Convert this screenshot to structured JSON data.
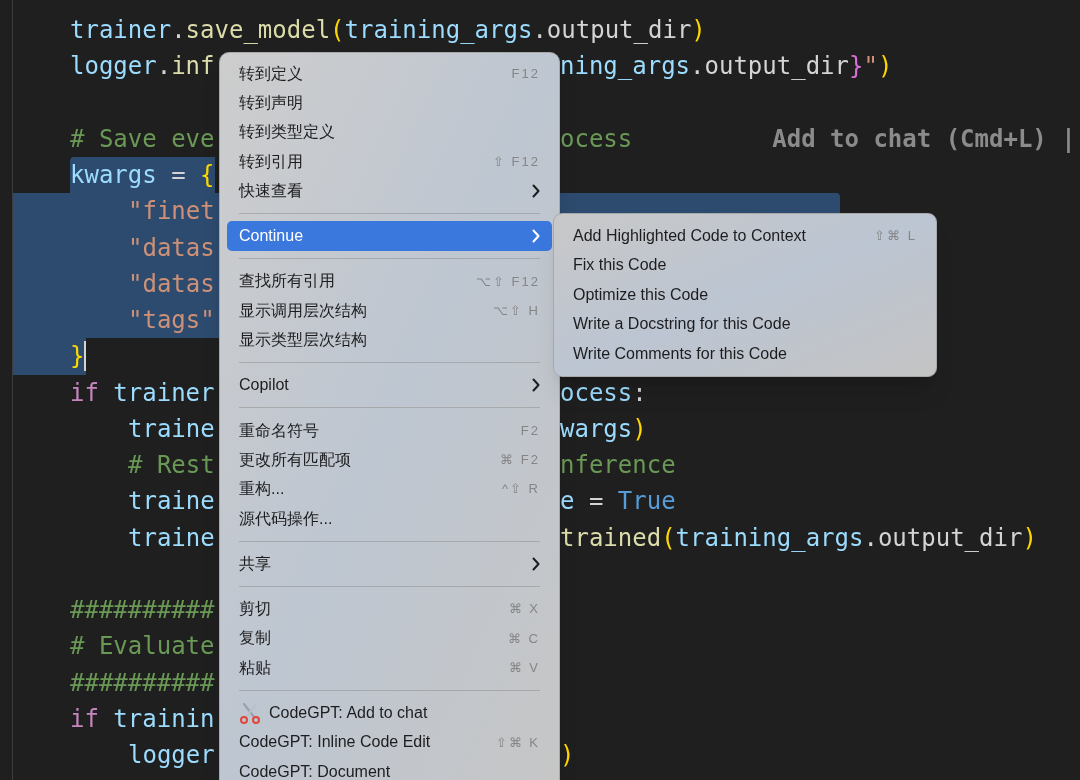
{
  "editor": {
    "lines": [
      {
        "kind": "code",
        "indented": false,
        "selected": false,
        "selection_start": false,
        "selection_end": false,
        "cursor": false,
        "left": [
          {
            "text": "trainer",
            "kind": "ident"
          },
          {
            "text": ".",
            "kind": "plain"
          },
          {
            "text": "save_model",
            "kind": "func"
          },
          {
            "text": "(",
            "kind": "paren"
          },
          {
            "text": "training_args",
            "kind": "ident"
          },
          {
            "text": ".",
            "kind": "plain"
          },
          {
            "text": "output_dir",
            "kind": "plain"
          },
          {
            "text": ")",
            "kind": "paren"
          }
        ]
      },
      {
        "kind": "code",
        "indented": false,
        "selected": false,
        "selection_start": false,
        "selection_end": false,
        "cursor": false,
        "left": [
          {
            "text": "logger",
            "kind": "ident"
          },
          {
            "text": ".",
            "kind": "plain"
          },
          {
            "text": "inf",
            "kind": "func"
          }
        ],
        "right": [
          {
            "text": "ning_args",
            "kind": "ident"
          },
          {
            "text": ".",
            "kind": "plain"
          },
          {
            "text": "output_dir",
            "kind": "plain"
          },
          {
            "text": "}",
            "kind": "brace"
          },
          {
            "text": "\"",
            "kind": "string"
          },
          {
            "text": ")",
            "kind": "paren"
          }
        ]
      },
      {
        "kind": "blank"
      },
      {
        "kind": "code",
        "indented": false,
        "selected": false,
        "selection_start": false,
        "selection_end": false,
        "cursor": false,
        "left": [
          {
            "text": "# Save eve",
            "kind": "comment"
          }
        ],
        "right": [
          {
            "text": "ocess",
            "kind": "comment"
          }
        ],
        "hint": "Add to chat (Cmd+L) |"
      },
      {
        "kind": "code",
        "indented": false,
        "selected": true,
        "selection_start": true,
        "selection_end": false,
        "cursor": false,
        "left": [
          {
            "text": "kwargs",
            "kind": "ident"
          },
          {
            "text": " = ",
            "kind": "plain"
          },
          {
            "text": "{",
            "kind": "paren"
          }
        ]
      },
      {
        "kind": "code",
        "indented": true,
        "selected": true,
        "selection_start": false,
        "selection_end": false,
        "cursor": false,
        "left": [
          {
            "text": "\"finet",
            "kind": "string"
          }
        ],
        "right_selected": true
      },
      {
        "kind": "code",
        "indented": true,
        "selected": true,
        "selection_start": false,
        "selection_end": false,
        "cursor": false,
        "left": [
          {
            "text": "\"datas",
            "kind": "string"
          }
        ]
      },
      {
        "kind": "code",
        "indented": true,
        "selected": true,
        "selection_start": false,
        "selection_end": false,
        "cursor": false,
        "left": [
          {
            "text": "\"datas",
            "kind": "string"
          }
        ]
      },
      {
        "kind": "code",
        "indented": true,
        "selected": true,
        "selection_start": false,
        "selection_end": false,
        "cursor": false,
        "left": [
          {
            "text": "\"tags\"",
            "kind": "string"
          }
        ]
      },
      {
        "kind": "code",
        "indented": false,
        "selected": true,
        "selection_start": false,
        "selection_end": true,
        "cursor": true,
        "left": [
          {
            "text": "}",
            "kind": "paren"
          }
        ]
      },
      {
        "kind": "code",
        "indented": false,
        "selected": false,
        "selection_start": false,
        "selection_end": false,
        "cursor": false,
        "left": [
          {
            "text": "if",
            "kind": "keyword"
          },
          {
            "text": " trainer",
            "kind": "ident"
          }
        ],
        "right": [
          {
            "text": "ocess",
            "kind": "ident"
          },
          {
            "text": ":",
            "kind": "plain"
          }
        ]
      },
      {
        "kind": "code",
        "indented": true,
        "selected": false,
        "selection_start": false,
        "selection_end": false,
        "cursor": false,
        "left": [
          {
            "text": "traine",
            "kind": "ident"
          }
        ],
        "right": [
          {
            "text": "wargs",
            "kind": "ident"
          },
          {
            "text": ")",
            "kind": "paren"
          }
        ]
      },
      {
        "kind": "code",
        "indented": true,
        "selected": false,
        "selection_start": false,
        "selection_end": false,
        "cursor": false,
        "left": [
          {
            "text": "# Rest",
            "kind": "comment"
          }
        ],
        "right": [
          {
            "text": "nference",
            "kind": "comment"
          }
        ]
      },
      {
        "kind": "code",
        "indented": true,
        "selected": false,
        "selection_start": false,
        "selection_end": false,
        "cursor": false,
        "left": [
          {
            "text": "traine",
            "kind": "ident"
          }
        ],
        "right": [
          {
            "text": "e",
            "kind": "ident"
          },
          {
            "text": " = ",
            "kind": "plain"
          },
          {
            "text": "True",
            "kind": "const"
          }
        ]
      },
      {
        "kind": "code",
        "indented": true,
        "selected": false,
        "selection_start": false,
        "selection_end": false,
        "cursor": false,
        "left": [
          {
            "text": "traine",
            "kind": "ident"
          }
        ],
        "right": [
          {
            "text": "trained",
            "kind": "func"
          },
          {
            "text": "(",
            "kind": "paren"
          },
          {
            "text": "training_args",
            "kind": "ident"
          },
          {
            "text": ".",
            "kind": "plain"
          },
          {
            "text": "output_dir",
            "kind": "plain"
          },
          {
            "text": ")",
            "kind": "paren"
          }
        ]
      },
      {
        "kind": "blank"
      },
      {
        "kind": "code",
        "indented": false,
        "selected": false,
        "selection_start": false,
        "selection_end": false,
        "cursor": false,
        "left": [
          {
            "text": "##########",
            "kind": "comment"
          }
        ]
      },
      {
        "kind": "code",
        "indented": false,
        "selected": false,
        "selection_start": false,
        "selection_end": false,
        "cursor": false,
        "left": [
          {
            "text": "# Evaluate",
            "kind": "comment"
          }
        ]
      },
      {
        "kind": "code",
        "indented": false,
        "selected": false,
        "selection_start": false,
        "selection_end": false,
        "cursor": false,
        "left": [
          {
            "text": "##########",
            "kind": "comment"
          }
        ]
      },
      {
        "kind": "code",
        "indented": false,
        "selected": false,
        "selection_start": false,
        "selection_end": false,
        "cursor": false,
        "left": [
          {
            "text": "if",
            "kind": "keyword"
          },
          {
            "text": " trainin",
            "kind": "ident"
          }
        ]
      },
      {
        "kind": "code",
        "indented": true,
        "selected": false,
        "selection_start": false,
        "selection_end": false,
        "cursor": false,
        "left": [
          {
            "text": "logger",
            "kind": "ident"
          }
        ],
        "right": [
          {
            "text": ")",
            "kind": "paren"
          }
        ]
      }
    ]
  },
  "context_menu": {
    "items": [
      {
        "kind": "item",
        "label": "转到定义",
        "shortcut": "F12",
        "submenu": false,
        "selected": false
      },
      {
        "kind": "item",
        "label": "转到声明",
        "submenu": false,
        "selected": false
      },
      {
        "kind": "item",
        "label": "转到类型定义",
        "submenu": false,
        "selected": false
      },
      {
        "kind": "item",
        "label": "转到引用",
        "shortcut": "⇧ F12",
        "submenu": false,
        "selected": false
      },
      {
        "kind": "item",
        "label": "快速查看",
        "submenu": true,
        "selected": false
      },
      {
        "kind": "separator"
      },
      {
        "kind": "item",
        "label": "Continue",
        "submenu": true,
        "selected": true
      },
      {
        "kind": "separator"
      },
      {
        "kind": "item",
        "label": "查找所有引用",
        "shortcut": "⌥⇧ F12",
        "submenu": false,
        "selected": false
      },
      {
        "kind": "item",
        "label": "显示调用层次结构",
        "shortcut": "⌥⇧ H",
        "submenu": false,
        "selected": false
      },
      {
        "kind": "item",
        "label": "显示类型层次结构",
        "submenu": false,
        "selected": false
      },
      {
        "kind": "separator"
      },
      {
        "kind": "item",
        "label": "Copilot",
        "submenu": true,
        "selected": false
      },
      {
        "kind": "separator"
      },
      {
        "kind": "item",
        "label": "重命名符号",
        "shortcut": "F2",
        "submenu": false,
        "selected": false
      },
      {
        "kind": "item",
        "label": "更改所有匹配项",
        "shortcut": "⌘ F2",
        "submenu": false,
        "selected": false
      },
      {
        "kind": "item",
        "label": "重构...",
        "shortcut": "^⇧ R",
        "submenu": false,
        "selected": false
      },
      {
        "kind": "item",
        "label": "源代码操作...",
        "submenu": false,
        "selected": false
      },
      {
        "kind": "separator"
      },
      {
        "kind": "item",
        "label": "共享",
        "submenu": true,
        "selected": false
      },
      {
        "kind": "separator"
      },
      {
        "kind": "item",
        "label": "剪切",
        "shortcut": "⌘ X",
        "submenu": false,
        "selected": false
      },
      {
        "kind": "item",
        "label": "复制",
        "shortcut": "⌘ C",
        "submenu": false,
        "selected": false
      },
      {
        "kind": "item",
        "label": "粘贴",
        "shortcut": "⌘ V",
        "submenu": false,
        "selected": false
      },
      {
        "kind": "separator"
      },
      {
        "kind": "icon_item",
        "label": "CodeGPT: Add to chat",
        "submenu": false,
        "selected": false
      },
      {
        "kind": "item",
        "label": "CodeGPT: Inline Code Edit",
        "shortcut": "⇧⌘ K",
        "submenu": false,
        "selected": false
      },
      {
        "kind": "item",
        "label": "CodeGPT: Document",
        "submenu": false,
        "selected": false
      }
    ]
  },
  "submenu": {
    "items": [
      {
        "label": "Add Highlighted Code to Context",
        "shortcut": "⇧⌘ L"
      },
      {
        "label": "Fix this Code"
      },
      {
        "label": "Optimize this Code"
      },
      {
        "label": "Write a Docstring for this Code"
      },
      {
        "label": "Write Comments for this Code"
      }
    ]
  }
}
